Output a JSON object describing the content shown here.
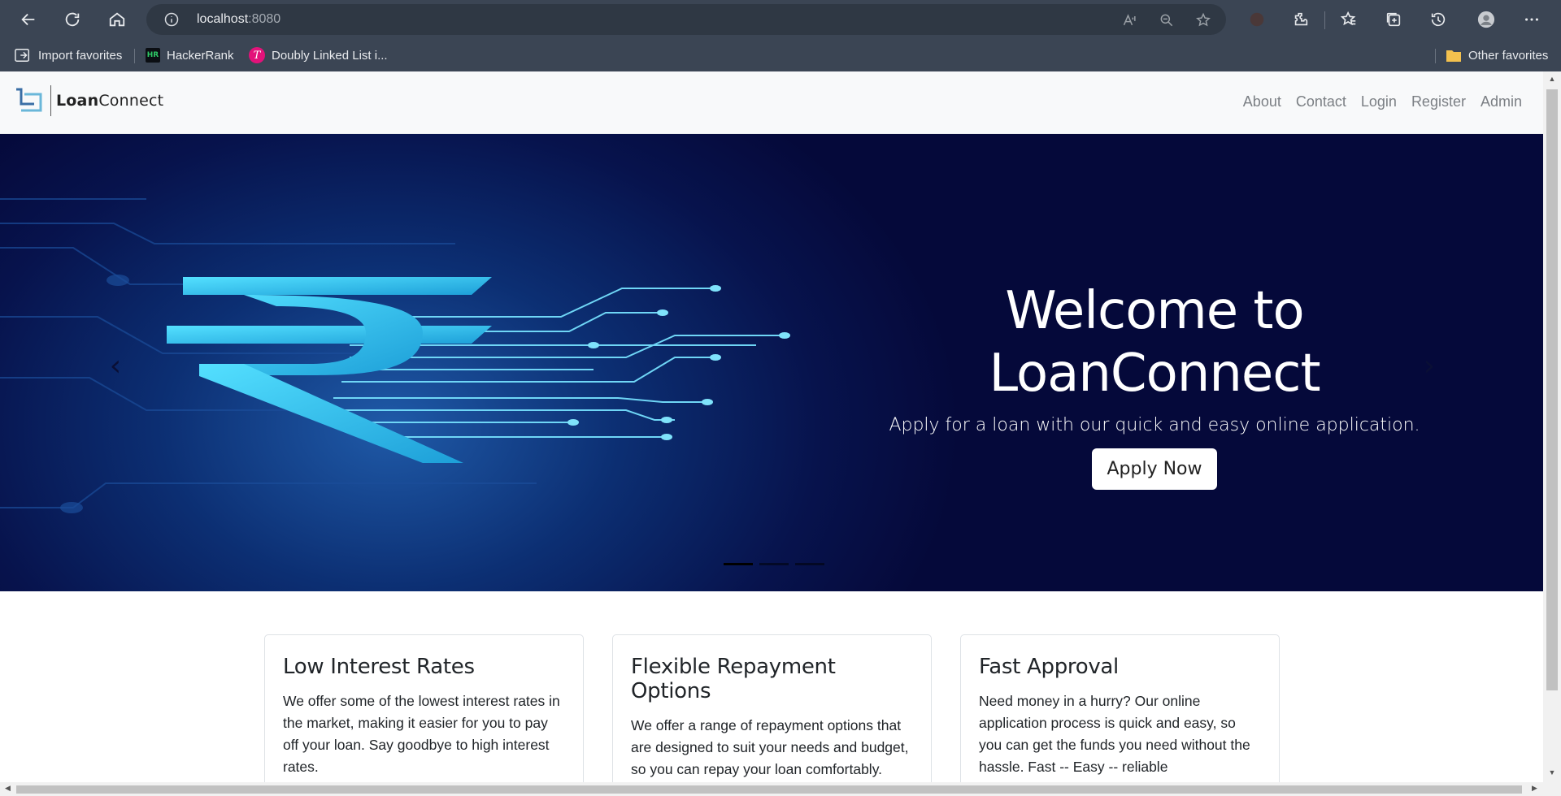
{
  "browser": {
    "url_host": "localhost",
    "url_port": ":8080",
    "bookmarks": [
      {
        "label": "Import favorites"
      },
      {
        "label": "HackerRank",
        "icon": "HR"
      },
      {
        "label": "Doubly Linked List i...",
        "icon": "T"
      }
    ],
    "other_favorites": "Other favorites"
  },
  "navbar": {
    "logo_bold": "Loan",
    "logo_rest": "Connect",
    "links": [
      "About",
      "Contact",
      "Login",
      "Register",
      "Admin"
    ]
  },
  "hero": {
    "title": "Welcome to LoanConnect",
    "subtitle": "Apply for a loan with our quick and easy online application.",
    "button": "Apply Now",
    "prev": "‹",
    "next": "›",
    "indicator_count": 3,
    "active_indicator": 0
  },
  "features": [
    {
      "title": "Low Interest Rates",
      "text": "We offer some of the lowest interest rates in the market, making it easier for you to pay off your loan. Say goodbye to high interest rates."
    },
    {
      "title": "Flexible Repayment Options",
      "text": "We offer a range of repayment options that are designed to suit your needs and budget, so you can repay your loan comfortably."
    },
    {
      "title": "Fast Approval",
      "text": "Need money in a hurry? Our online application process is quick and easy, so you can get the funds you need without the hassle. Fast -- Easy -- reliable"
    }
  ],
  "colors": {
    "browser_chrome": "#3b4554",
    "hero_bg": "#07134d",
    "rupee": "#3fd7f2"
  }
}
